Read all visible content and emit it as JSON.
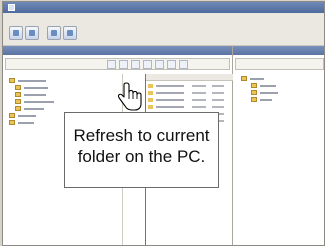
{
  "tooltip": {
    "line1": "Refresh to current",
    "line2": "folder on the PC."
  },
  "icons": {
    "cursor": "hand-pointer-icon",
    "toolbar": [
      "refresh-icon",
      "stop-icon",
      "connect-icon",
      "disconnect-icon"
    ]
  },
  "colors": {
    "titlebar": "#5b74a6",
    "folder": "#e9c35c"
  }
}
